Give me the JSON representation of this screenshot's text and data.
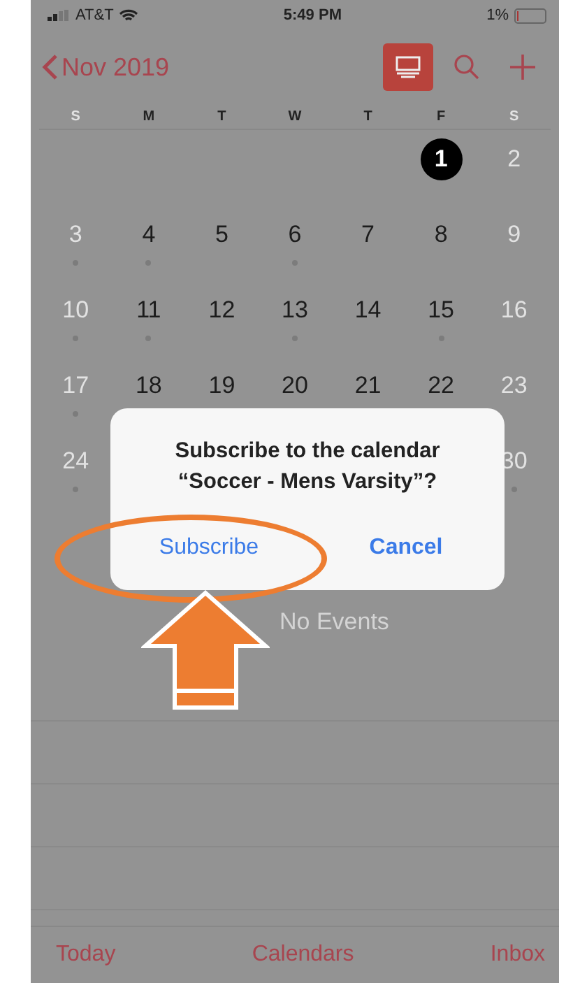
{
  "status_bar": {
    "carrier": "AT&T",
    "time": "5:49 PM",
    "battery": "1%"
  },
  "nav": {
    "back_label": "Nov 2019",
    "list_view_on": true
  },
  "weekdays": [
    "S",
    "M",
    "T",
    "W",
    "T",
    "F",
    "S"
  ],
  "weeks": [
    {
      "right": [
        {
          "day": "1",
          "selected": true,
          "weekend": false,
          "dot": false
        },
        {
          "day": "2",
          "selected": false,
          "weekend": true,
          "dot": false
        }
      ]
    },
    {
      "left": [
        {
          "day": "3",
          "selected": false,
          "weekend": true,
          "dot": true
        },
        {
          "day": "4",
          "selected": false,
          "weekend": false,
          "dot": true
        },
        {
          "day": "5",
          "selected": false,
          "weekend": false,
          "dot": false
        },
        {
          "day": "6",
          "selected": false,
          "weekend": false,
          "dot": true
        },
        {
          "day": "7",
          "selected": false,
          "weekend": false,
          "dot": false
        },
        {
          "day": "8",
          "selected": false,
          "weekend": false,
          "dot": false
        },
        {
          "day": "9",
          "selected": false,
          "weekend": true,
          "dot": false
        }
      ]
    },
    {
      "left": [
        {
          "day": "10",
          "selected": false,
          "weekend": true,
          "dot": true
        },
        {
          "day": "11",
          "selected": false,
          "weekend": false,
          "dot": true
        },
        {
          "day": "12",
          "selected": false,
          "weekend": false,
          "dot": false
        },
        {
          "day": "13",
          "selected": false,
          "weekend": false,
          "dot": true
        },
        {
          "day": "14",
          "selected": false,
          "weekend": false,
          "dot": false
        },
        {
          "day": "15",
          "selected": false,
          "weekend": false,
          "dot": true
        },
        {
          "day": "16",
          "selected": false,
          "weekend": true,
          "dot": false
        }
      ]
    },
    {
      "left": [
        {
          "day": "17",
          "selected": false,
          "weekend": true,
          "dot": true
        },
        {
          "day": "18",
          "selected": false,
          "weekend": false,
          "dot": false
        },
        {
          "day": "19",
          "selected": false,
          "weekend": false,
          "dot": false
        },
        {
          "day": "20",
          "selected": false,
          "weekend": false,
          "dot": false
        },
        {
          "day": "21",
          "selected": false,
          "weekend": false,
          "dot": false
        },
        {
          "day": "22",
          "selected": false,
          "weekend": false,
          "dot": false
        },
        {
          "day": "23",
          "selected": false,
          "weekend": true,
          "dot": false
        }
      ]
    },
    {
      "left": [
        {
          "day": "24",
          "selected": false,
          "weekend": true,
          "dot": true
        }
      ],
      "right": [
        {
          "day": "30",
          "selected": false,
          "weekend": true,
          "dot": true
        }
      ]
    }
  ],
  "events_placeholder": "No Events",
  "dialog": {
    "message": "Subscribe to the calendar “Soccer - Mens Varsity”?",
    "buttons": [
      {
        "label": "Subscribe",
        "highlighted": true
      },
      {
        "label": "Cancel",
        "highlighted": false
      }
    ]
  },
  "tab_bar": [
    "Today",
    "Calendars",
    "Inbox"
  ]
}
